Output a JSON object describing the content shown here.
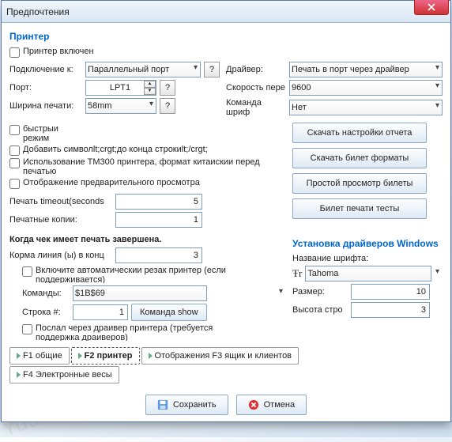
{
  "window": {
    "title": "Предпочтения"
  },
  "printer": {
    "heading": "Принтер",
    "enabled_label": "Принтер включен",
    "connection_label": "Подключение к:",
    "connection_value": "Параллельный порт",
    "port_label": "Порт:",
    "port_value": "LPT1",
    "width_label": "Ширина печати:",
    "width_value": "58mm",
    "driver_label": "Драйвер:",
    "driver_value": "Печать в порт через драйвер",
    "speed_label": "Скорость пере",
    "speed_value": "9600",
    "font_cmd_label": "Команда шриф",
    "font_cmd_value": "Нет",
    "cb_fast": "быстрыи режим",
    "cb_add_symbol": "Добавить символlt;crgt;до конца строкиlt;/crgt;",
    "cb_tm300": "Использование TM300 принтера, формат китаискии перед печатью",
    "cb_preview": "Отображение предварительного просмотра",
    "timeout_label": "Печать timeout(seconds",
    "timeout_value": "5",
    "copies_label": "Печатные копии:",
    "copies_value": "1",
    "btn_download_report": "Скачать настройки отчета",
    "btn_download_ticket": "Скачать билет форматы",
    "btn_simple_view": "Простой просмотр билеты",
    "btn_print_tests": "Билет печати тесты"
  },
  "post": {
    "heading": "Когда чек имеет печать завершена.",
    "feed_label": "Корма линия (ы) в конц",
    "feed_value": "3",
    "cb_autocut": "Включите автоматическии резак принтер (если поддерживается)",
    "commands_label": "Команды:",
    "commands_value": "$1B$69",
    "line_no_label": "Строка #:",
    "line_no_value": "1",
    "btn_show": "Команда show",
    "cb_via_driver": "Послал через драивер принтера (требуется поддержка драиверов)"
  },
  "drivers": {
    "heading": "Установка драйверов Windows",
    "font_name_label": "Название шрифта:",
    "font_name_value": "Tahoma",
    "size_label": "Размер:",
    "size_value": "10",
    "row_height_label": "Высота стро",
    "row_height_value": "3"
  },
  "tabs": {
    "t1": "F1 общие",
    "t2": "F2 принтер",
    "t3": "Отображения F3 ящик и клиентов",
    "t4": "F4 Электронные весы"
  },
  "footer": {
    "save": "Сохранить",
    "cancel": "Отмена"
  }
}
